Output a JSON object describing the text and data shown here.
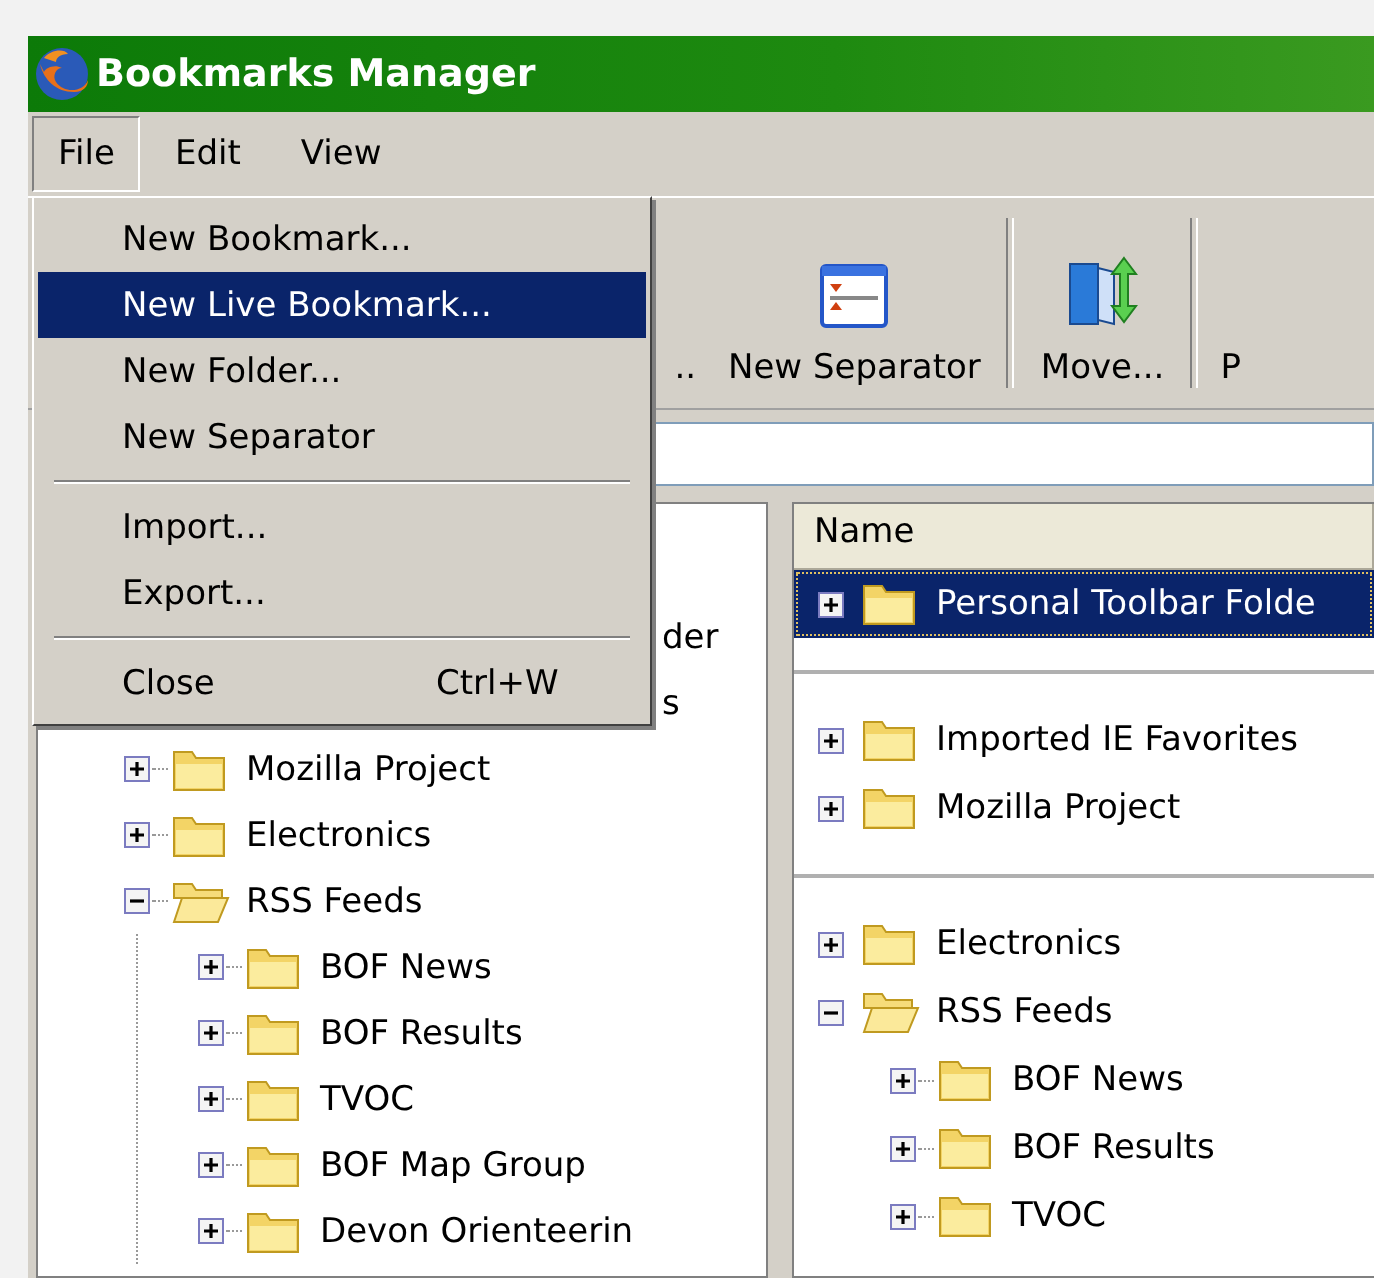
{
  "window": {
    "title": "Bookmarks Manager"
  },
  "menu_bar": [
    {
      "label": "File",
      "selected": true
    },
    {
      "label": "Edit",
      "selected": false
    },
    {
      "label": "View",
      "selected": false
    }
  ],
  "file_menu": [
    {
      "kind": "item",
      "label": "New Bookmark...",
      "selected": false
    },
    {
      "kind": "item",
      "label": "New Live Bookmark...",
      "selected": true
    },
    {
      "kind": "item",
      "label": "New Folder...",
      "selected": false
    },
    {
      "kind": "item",
      "label": "New Separator",
      "selected": false
    },
    {
      "kind": "separator"
    },
    {
      "kind": "item",
      "label": "Import...",
      "selected": false
    },
    {
      "kind": "item",
      "label": "Export...",
      "selected": false
    },
    {
      "kind": "separator"
    },
    {
      "kind": "item",
      "label": "Close",
      "shortcut": "Ctrl+W",
      "selected": false
    }
  ],
  "toolbar": [
    {
      "kind": "cut-left",
      "label": ".."
    },
    {
      "kind": "separator-tool",
      "label": "New Separator"
    },
    {
      "kind": "move-tool",
      "label": "Move..."
    },
    {
      "kind": "cut-right",
      "label": "P"
    }
  ],
  "folder_tree": [
    {
      "kind": "covered",
      "label": "der"
    },
    {
      "kind": "covered",
      "label": "s"
    },
    {
      "kind": "folder",
      "label": "Mozilla Project",
      "expanded": false
    },
    {
      "kind": "folder",
      "label": "Electronics",
      "expanded": false
    },
    {
      "kind": "folder",
      "label": "RSS Feeds",
      "expanded": true,
      "children": [
        {
          "label": "BOF News",
          "expanded": false
        },
        {
          "label": "BOF Results",
          "expanded": false
        },
        {
          "label": "TVOC",
          "expanded": false
        },
        {
          "label": "BOF Map Group",
          "expanded": false
        },
        {
          "label": "Devon Orienteerin",
          "expanded": false
        }
      ]
    }
  ],
  "bookmark_list": {
    "columns": [
      "Name"
    ],
    "rows": [
      {
        "kind": "folder",
        "label": "Personal Toolbar Folde",
        "expanded": false,
        "selected": true
      },
      {
        "kind": "separator"
      },
      {
        "kind": "folder",
        "label": "Imported IE Favorites",
        "expanded": false,
        "selected": false
      },
      {
        "kind": "folder",
        "label": "Mozilla Project",
        "expanded": false,
        "selected": false
      },
      {
        "kind": "separator"
      },
      {
        "kind": "folder",
        "label": "Electronics",
        "expanded": false,
        "selected": false
      },
      {
        "kind": "folder",
        "label": "RSS Feeds",
        "expanded": true,
        "selected": false,
        "children": [
          {
            "label": "BOF News",
            "expanded": false,
            "selected": false
          },
          {
            "label": "BOF Results",
            "expanded": false,
            "selected": false
          },
          {
            "label": "TVOC",
            "expanded": false,
            "selected": false
          }
        ]
      }
    ]
  }
}
